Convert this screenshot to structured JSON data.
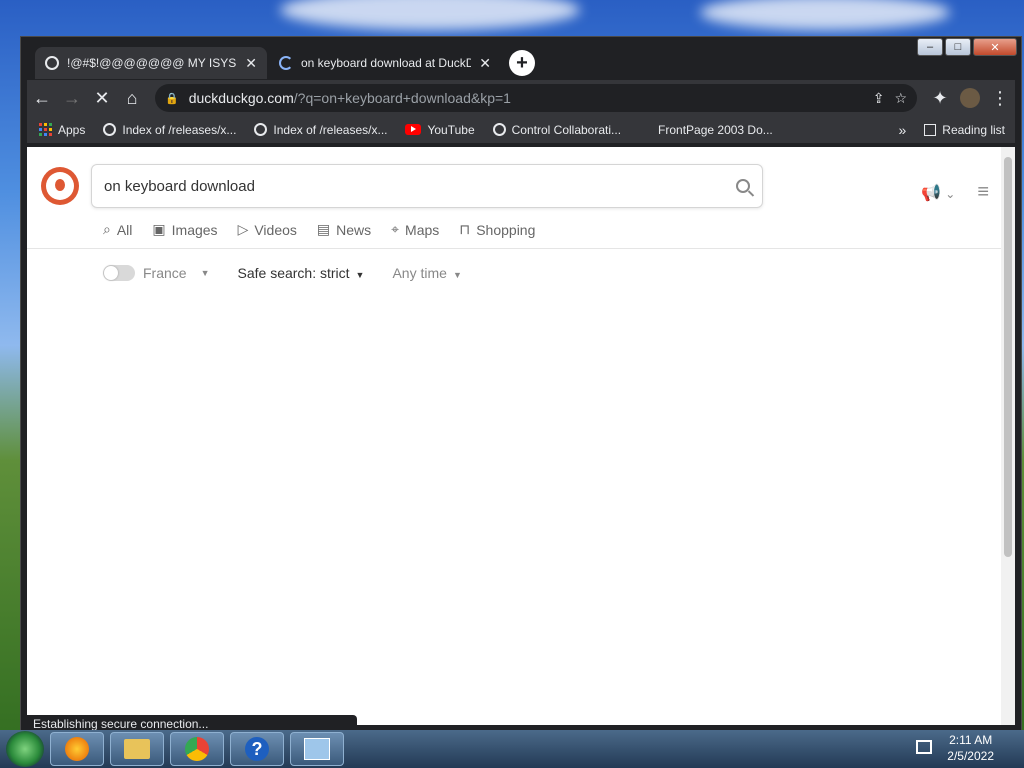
{
  "window": {
    "tabs": [
      {
        "title": "!@#$!@@@@@@@ MY ISYS PF",
        "close": "✕",
        "active": true
      },
      {
        "title": "on keyboard download at DuckD",
        "close": "✕",
        "active": false
      }
    ],
    "new_tab": "+",
    "controls": {
      "minimize": "–",
      "maximize": "□",
      "close": "✕"
    }
  },
  "toolbar": {
    "back": "←",
    "forward": "→",
    "stop": "✕",
    "home": "⌂",
    "lock": "🔒",
    "url_host": "duckduckgo.com",
    "url_path": "/?q=on+keyboard+download&kp=1",
    "share": "⇪",
    "star": "☆",
    "extensions": "✦",
    "menu": "⋮"
  },
  "bookmarks": {
    "apps": "Apps",
    "items": [
      {
        "label": "Index of /releases/x...",
        "icon": "globe-icon"
      },
      {
        "label": "Index of /releases/x...",
        "icon": "globe-icon"
      },
      {
        "label": "YouTube",
        "icon": "youtube-icon"
      },
      {
        "label": "Control Collaborati...",
        "icon": "globe-icon"
      },
      {
        "label": "FrontPage 2003 Do...",
        "icon": "blank-icon"
      }
    ],
    "overflow": "»",
    "reading_list": "Reading list"
  },
  "page": {
    "search_value": "on keyboard download",
    "nav": [
      {
        "label": "All",
        "icon": "search-icon",
        "glyph": "⌕"
      },
      {
        "label": "Images",
        "icon": "image-icon",
        "glyph": "▣"
      },
      {
        "label": "Videos",
        "icon": "play-icon",
        "glyph": "▷"
      },
      {
        "label": "News",
        "icon": "news-icon",
        "glyph": "▤"
      },
      {
        "label": "Maps",
        "icon": "map-pin-icon",
        "glyph": "⌖"
      },
      {
        "label": "Shopping",
        "icon": "bag-icon",
        "glyph": "⊓"
      }
    ],
    "filters": {
      "region": "France",
      "safe_search": "Safe search: strict",
      "time": "Any time",
      "caret": "▼"
    },
    "menu_icon": "≡",
    "megaphone": "📢",
    "chevron": "⌄"
  },
  "status_text": "Establishing secure connection...",
  "taskbar": {
    "time": "2:11 AM",
    "date": "2/5/2022",
    "help": "?"
  },
  "colors": {
    "ddg_orange": "#de5833",
    "chrome_dark": "#35363a"
  }
}
